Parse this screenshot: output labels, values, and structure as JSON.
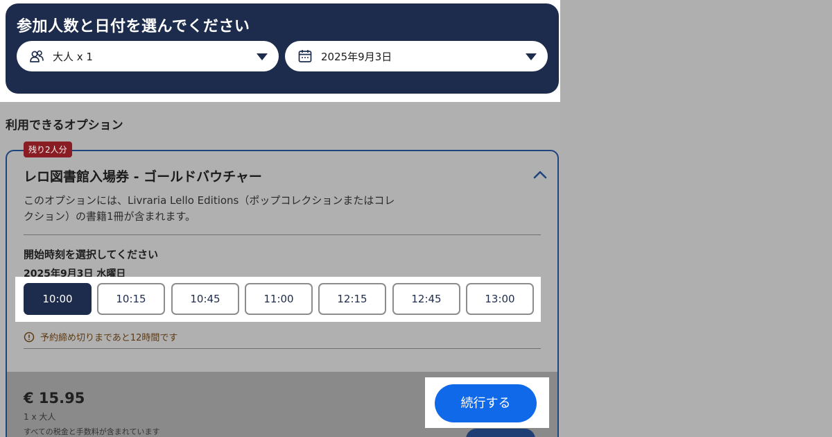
{
  "header": {
    "title": "参加人数と日付を選んでください",
    "participants": {
      "label": "大人 x 1",
      "icon": "people-icon"
    },
    "date": {
      "label": "2025年9月3日",
      "icon": "calendar-icon"
    }
  },
  "options_section": {
    "title": "利用できるオプション"
  },
  "option": {
    "badge": "残り2人分",
    "title": "レロ図書館入場券 - ゴールドバウチャー",
    "description": "このオプションには、Livraria Lello Editions（ポップコレクションまたはコレクション）の書籍1冊が含まれます。",
    "select_time_label": "開始時刻を選択してください",
    "date_label": "2025年9月3日 水曜日",
    "times": [
      "10:00",
      "10:15",
      "10:45",
      "11:00",
      "12:15",
      "12:45",
      "13:00"
    ],
    "selected_time": "10:00",
    "deadline_text": "予約締め切りまであと12時間です",
    "price": "€ 15.95",
    "quantity": "1 x 大人",
    "tax_note": "すべての税金と手数料が含まれています",
    "continue_label": "続行する"
  },
  "colors": {
    "navy": "#1d2c4c",
    "accent_blue": "#1069e8",
    "badge_red": "#8a1d24",
    "overlay_gray": "#b0b0b0"
  }
}
